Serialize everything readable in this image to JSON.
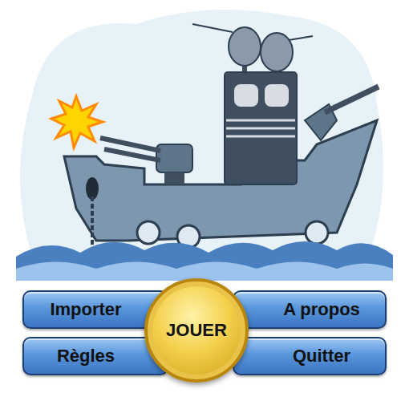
{
  "buttons": [
    "Importer",
    "A propos",
    "Règles",
    "Quitter"
  ],
  "play_button": "JOUER"
}
